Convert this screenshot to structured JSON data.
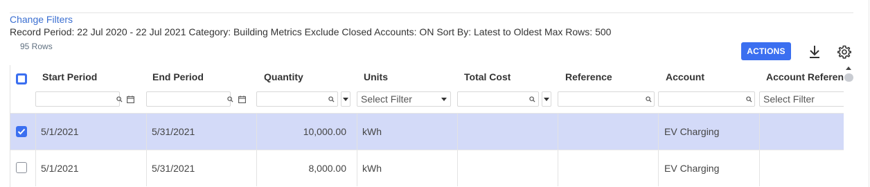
{
  "filters": {
    "change_filters_label": "Change Filters",
    "summary": "Record Period: 22 Jul 2020 - 22 Jul 2021 Category: Building Metrics Exclude Closed Accounts: ON Sort By: Latest to Oldest Max Rows: 500",
    "row_count": "95 Rows"
  },
  "toolbar": {
    "actions_label": "ACTIONS",
    "download_icon": "download-icon",
    "settings_icon": "gear-icon"
  },
  "table": {
    "columns": {
      "start_period": "Start Period",
      "end_period": "End Period",
      "quantity": "Quantity",
      "units": "Units",
      "total_cost": "Total Cost",
      "reference": "Reference",
      "account": "Account",
      "account_reference": "Account Reference"
    },
    "filter_placeholders": {
      "units": "Select Filter",
      "account_reference": "Select Filter"
    },
    "rows": [
      {
        "selected": true,
        "start_period": "5/1/2021",
        "end_period": "5/31/2021",
        "quantity": "10,000.00",
        "units": "kWh",
        "total_cost": "",
        "reference": "",
        "account": "EV Charging",
        "account_reference": ""
      },
      {
        "selected": false,
        "start_period": "5/1/2021",
        "end_period": "5/31/2021",
        "quantity": "8,000.00",
        "units": "kWh",
        "total_cost": "",
        "reference": "",
        "account": "EV Charging",
        "account_reference": ""
      }
    ]
  },
  "colors": {
    "accent": "#3b6ff0",
    "link": "#3b6fd1",
    "selected_row": "#d3daf8"
  }
}
